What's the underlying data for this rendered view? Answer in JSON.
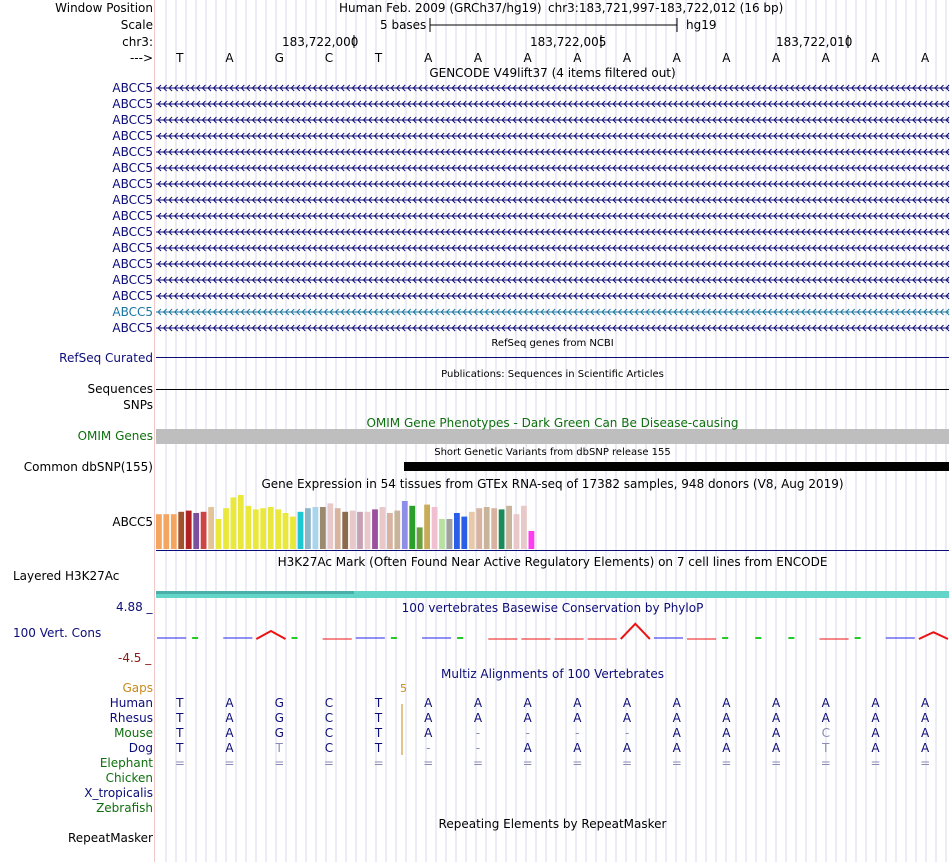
{
  "header": {
    "window_position_label": "Window Position",
    "scale_label": "Scale",
    "chrom_label": "chr3:",
    "strand_label": "--->",
    "assembly": "Human Feb. 2009 (GRCh37/hg19)",
    "position": "chr3:183,721,997-183,722,012 (16 bp)",
    "scale_text": "5 bases",
    "db": "hg19",
    "ruler_positions": [
      "183,722,000",
      "183,722,005",
      "183,722,010"
    ]
  },
  "sequence": [
    "T",
    "A",
    "G",
    "C",
    "T",
    "A",
    "A",
    "A",
    "A",
    "A",
    "A",
    "A",
    "A",
    "A",
    "A",
    "A"
  ],
  "gencode": {
    "title": "GENCODE V49lift37 (4 items filtered out)",
    "items": [
      "ABCC5",
      "ABCC5",
      "ABCC5",
      "ABCC5",
      "ABCC5",
      "ABCC5",
      "ABCC5",
      "ABCC5",
      "ABCC5",
      "ABCC5",
      "ABCC5",
      "ABCC5",
      "ABCC5",
      "ABCC5",
      "ABCC5",
      "ABCC5"
    ],
    "highlight_index": 14,
    "colors": {
      "normal": "#0c0c78",
      "highlight": "#1a75a0"
    }
  },
  "refseq": {
    "title": "RefSeq genes from NCBI",
    "label": "RefSeq Curated"
  },
  "publications": {
    "title": "Publications: Sequences in Scientific Articles",
    "label": "Sequences"
  },
  "snps_label": "SNPs",
  "omim": {
    "title": "OMIM Gene Phenotypes - Dark Green Can Be Disease-causing",
    "label": "OMIM Genes",
    "color": "#0e6f0e"
  },
  "dbsnp": {
    "title": "Short Genetic Variants from dbSNP release 155",
    "label": "Common dbSNP(155)"
  },
  "gtex": {
    "title": "Gene Expression in 54 tissues from GTEx RNA-seq of 17382 samples, 948 donors (V8, Aug 2019)",
    "label": "ABCC5",
    "bar_values": [
      0.58,
      0.58,
      0.58,
      0.62,
      0.64,
      0.6,
      0.62,
      0.7,
      0.5,
      0.68,
      0.86,
      0.9,
      0.72,
      0.66,
      0.68,
      0.7,
      0.66,
      0.6,
      0.54,
      0.62,
      0.68,
      0.7,
      0.7,
      0.76,
      0.68,
      0.62,
      0.64,
      0.62,
      0.62,
      0.66,
      0.7,
      0.6,
      0.64,
      0.8,
      0.72,
      0.36,
      0.74,
      0.7,
      0.5,
      0.5,
      0.6,
      0.54,
      0.62,
      0.68,
      0.7,
      0.68,
      0.66,
      0.72,
      0.58,
      0.72,
      0.3
    ],
    "bar_colors": [
      "#f4a55f",
      "#f4a55f",
      "#f4a55f",
      "#a0522d",
      "#b22222",
      "#7b4f9d",
      "#cc4444",
      "#e3c49a",
      "#ebe83c",
      "#ebe83c",
      "#ebe83c",
      "#ebe83c",
      "#ebe83c",
      "#ebe83c",
      "#ebe83c",
      "#ebe83c",
      "#ebe83c",
      "#ebe83c",
      "#ebe83c",
      "#1ec8d0",
      "#8db4c8",
      "#a8d4ec",
      "#9b8a6e",
      "#e8c8c8",
      "#d8b4a0",
      "#8b6a4e",
      "#e8c8c8",
      "#c8a0b4",
      "#e8c8c8",
      "#9b4f9d",
      "#e8c8c8",
      "#d8b4a0",
      "#c8b49b",
      "#8e8ee8",
      "#2aa02a",
      "#6aa03a",
      "#c8ac5a",
      "#f0c0d0",
      "#b8e0a0",
      "#a0a0a0",
      "#2a5ee8",
      "#2a5ee8",
      "#e8c8a8",
      "#d8b4a0",
      "#c8b49b",
      "#d8b4a0",
      "#1a8a5a",
      "#c8b49b",
      "#e8c8c8",
      "#e8c8c8",
      "#ff3cf0"
    ]
  },
  "h3k27ac": {
    "title": "H3K27Ac Mark (Often Found Near Active Regulatory Elements) on 7 cell lines from ENCODE",
    "label": "Layered H3K27Ac"
  },
  "phylop": {
    "title": "100 vertebrates Basewise Conservation by PhyloP",
    "label": "100 Vert. Cons",
    "max": "4.88 _",
    "min": "-4.5 _",
    "values": [
      0.2,
      0,
      0.3,
      1.0,
      0,
      -0.2,
      0.1,
      0,
      0.1,
      0,
      -0.3,
      -0.2,
      -0.3,
      -0.2,
      2.2,
      0.4,
      -0.2,
      0,
      0,
      0,
      -0.2,
      0,
      0.2,
      0.8
    ]
  },
  "multiz": {
    "title": "Multiz Alignments of 100 Vertebrates",
    "gaps_label": "Gaps",
    "gap_count": "5",
    "species": [
      {
        "name": "Human",
        "seq": [
          "T",
          "A",
          "G",
          "C",
          "T",
          "A",
          "A",
          "A",
          "A",
          "A",
          "A",
          "A",
          "A",
          "A",
          "A",
          "A"
        ],
        "color": "#0c0c78"
      },
      {
        "name": "Rhesus",
        "seq": [
          "T",
          "A",
          "G",
          "C",
          "T",
          "A",
          "A",
          "A",
          "A",
          "A",
          "A",
          "A",
          "A",
          "A",
          "A",
          "A"
        ],
        "color": "#0c0c78"
      },
      {
        "name": "Mouse",
        "seq": [
          "T",
          "A",
          "G",
          "C",
          "T",
          "A",
          "-",
          "-",
          "-",
          "-",
          "A",
          "A",
          "A",
          "C",
          "A",
          "A"
        ],
        "color": "#0e6f0e"
      },
      {
        "name": "Dog",
        "seq": [
          "T",
          "A",
          "T",
          "C",
          "T",
          "-",
          "-",
          "A",
          "A",
          "A",
          "A",
          "A",
          "A",
          "T",
          "A",
          "A"
        ],
        "color": "#0c0c78"
      },
      {
        "name": "Elephant",
        "seq": [
          "=",
          "=",
          "=",
          "=",
          "=",
          "=",
          "=",
          "=",
          "=",
          "=",
          "=",
          "=",
          "=",
          "=",
          "=",
          "="
        ],
        "color": "#0e6f0e"
      },
      {
        "name": "Chicken",
        "seq": [],
        "color": "#0e6f0e"
      },
      {
        "name": "X_tropicalis",
        "seq": [],
        "color": "#0c0c78"
      },
      {
        "name": "Zebrafish",
        "seq": [],
        "color": "#0e6f0e"
      }
    ]
  },
  "repeatmasker": {
    "title": "Repeating Elements by RepeatMasker",
    "label": "RepeatMasker"
  }
}
